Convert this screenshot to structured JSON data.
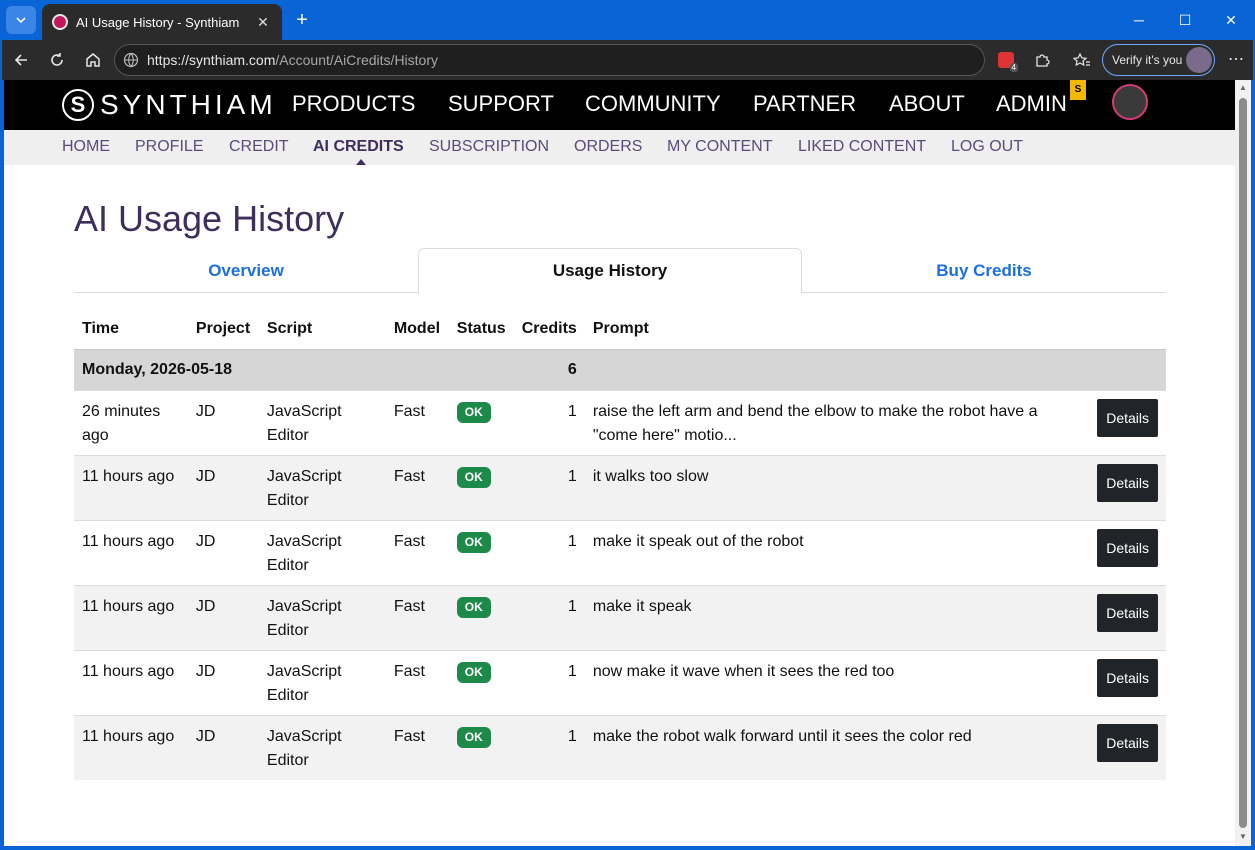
{
  "browser": {
    "tab_title": "AI Usage History - Synthiam",
    "url_host": "https://synthiam.com",
    "url_path": "/Account/AiCredits/History",
    "verify_label": "Verify it's you",
    "extension_badge": "4"
  },
  "header": {
    "logo_text": "SYNTHIAM",
    "nav": [
      "PRODUCTS",
      "SUPPORT",
      "COMMUNITY",
      "PARTNER",
      "ABOUT",
      "ADMIN"
    ],
    "admin_badge": "S"
  },
  "sub_nav": {
    "items": [
      "HOME",
      "PROFILE",
      "CREDIT",
      "AI CREDITS",
      "SUBSCRIPTION",
      "ORDERS",
      "MY CONTENT",
      "LIKED CONTENT",
      "LOG OUT"
    ],
    "active": "AI CREDITS"
  },
  "page": {
    "title": "AI Usage History",
    "tabs": [
      "Overview",
      "Usage History",
      "Buy Credits"
    ],
    "active_tab": "Usage History"
  },
  "table": {
    "headers": [
      "Time",
      "Project",
      "Script",
      "Model",
      "Status",
      "Credits",
      "Prompt"
    ],
    "group": {
      "label": "Monday, 2026-05-18",
      "credits": "6"
    },
    "details_label": "Details",
    "rows": [
      {
        "time": "26 minutes ago",
        "project": "JD",
        "script": "JavaScript Editor",
        "model": "Fast",
        "status": "OK",
        "credits": "1",
        "prompt": "raise the left arm and bend the elbow to make the robot have a \"come here\" motio..."
      },
      {
        "time": "11 hours ago",
        "project": "JD",
        "script": "JavaScript Editor",
        "model": "Fast",
        "status": "OK",
        "credits": "1",
        "prompt": "it walks too slow"
      },
      {
        "time": "11 hours ago",
        "project": "JD",
        "script": "JavaScript Editor",
        "model": "Fast",
        "status": "OK",
        "credits": "1",
        "prompt": "make it speak out of the robot"
      },
      {
        "time": "11 hours ago",
        "project": "JD",
        "script": "JavaScript Editor",
        "model": "Fast",
        "status": "OK",
        "credits": "1",
        "prompt": "make it speak"
      },
      {
        "time": "11 hours ago",
        "project": "JD",
        "script": "JavaScript Editor",
        "model": "Fast",
        "status": "OK",
        "credits": "1",
        "prompt": "now make it wave when it sees the red too"
      },
      {
        "time": "11 hours ago",
        "project": "JD",
        "script": "JavaScript Editor",
        "model": "Fast",
        "status": "OK",
        "credits": "1",
        "prompt": "make the robot walk forward until it sees the color red"
      }
    ]
  },
  "colors": {
    "brand_purple": "#3d2e5c",
    "link_blue": "#1b6fe0",
    "status_ok": "#1e8a4a",
    "admin_badge": "#f5b800"
  }
}
